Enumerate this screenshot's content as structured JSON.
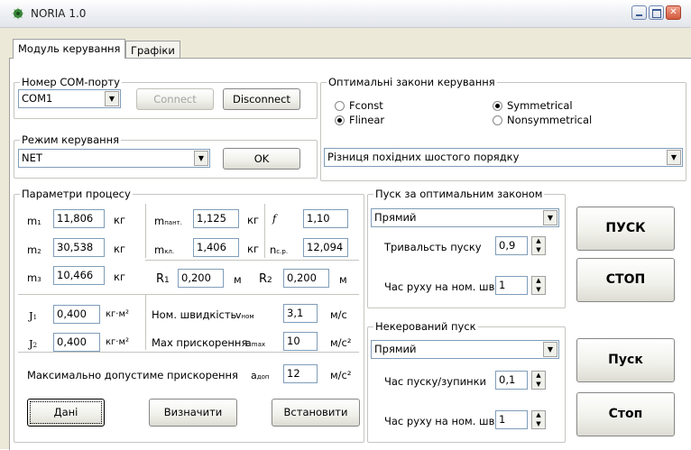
{
  "window": {
    "title": "NORIA 1.0"
  },
  "tabs": [
    "Модуль керування",
    "Графіки"
  ],
  "com_port": {
    "legend": "Номер COM-порту",
    "value": "COM1",
    "connect_label": "Connect",
    "disconnect_label": "Disconnect"
  },
  "control_mode": {
    "legend": "Режим керування",
    "value": "NET",
    "ok_label": "OK"
  },
  "optimal_laws": {
    "legend": "Оптимальні закони керування",
    "options": [
      {
        "label": "Fconst",
        "checked": false
      },
      {
        "label": "Flinear",
        "checked": true
      },
      {
        "label": "Symmetrical",
        "checked": true
      },
      {
        "label": "Nonsymmetrical",
        "checked": false
      }
    ],
    "criterion": "Різниця похідних шостого порядку"
  },
  "process": {
    "legend": "Параметри процесу",
    "m1": {
      "sym": "m",
      "sub": "1",
      "value": "11,806",
      "unit": "кг"
    },
    "m2": {
      "sym": "m",
      "sub": "2",
      "value": "30,538",
      "unit": "кг"
    },
    "m3": {
      "sym": "m",
      "sub": "3",
      "value": "10,466",
      "unit": "кг"
    },
    "m_pant": {
      "sym": "m",
      "sub": "пант.",
      "value": "1,125",
      "unit": "кг"
    },
    "m_kl": {
      "sym": "m",
      "sub": "кл.",
      "value": "1,406",
      "unit": "кг"
    },
    "f": {
      "sym": "f",
      "value": "1,10"
    },
    "n_sr": {
      "sym": "n",
      "sub": "с.р.",
      "value": "12,094"
    },
    "R1": {
      "sym": "R",
      "sub": "1",
      "value": "0,200",
      "unit": "м"
    },
    "R2": {
      "sym": "R",
      "sub": "2",
      "value": "0,200",
      "unit": "м"
    },
    "J1": {
      "sym": "J",
      "sub": "1",
      "value": "0,400",
      "unit": "кг·м²"
    },
    "J2": {
      "sym": "J",
      "sub": "2",
      "value": "0,400",
      "unit": "кг·м²"
    },
    "v_nom": {
      "label": "Ном. швидкість",
      "sym": "v",
      "sub": "ном",
      "value": "3,1",
      "unit": "м/с"
    },
    "a_max": {
      "label": "Max прискорення",
      "sym": "a",
      "sub": "max",
      "value": "10",
      "unit": "м/с²"
    },
    "a_dop": {
      "label": "Максимально допустиме прискорення",
      "sym": "a",
      "sub": "доп",
      "value": "12",
      "unit": "м/с²"
    },
    "btn_data": "Дані",
    "btn_define": "Визначити",
    "btn_set": "Встановити"
  },
  "optimal_start": {
    "legend": "Пуск за оптимальним законом",
    "direction": "Прямий",
    "duration_label": "Тривальсть пуску",
    "duration": "0,9",
    "time_label": "Час руху на ном. шв.",
    "time": "1",
    "start_label": "ПУСК",
    "stop_label": "СТОП"
  },
  "uncontrolled_start": {
    "legend": "Некерований пуск",
    "direction": "Прямий",
    "start_stop_label": "Час пуску/зупинки",
    "start_stop_time": "0,1",
    "time_label": "Час руху на ном. шв.",
    "time": "1",
    "start_label": "Пуск",
    "stop_label": "Стоп"
  }
}
